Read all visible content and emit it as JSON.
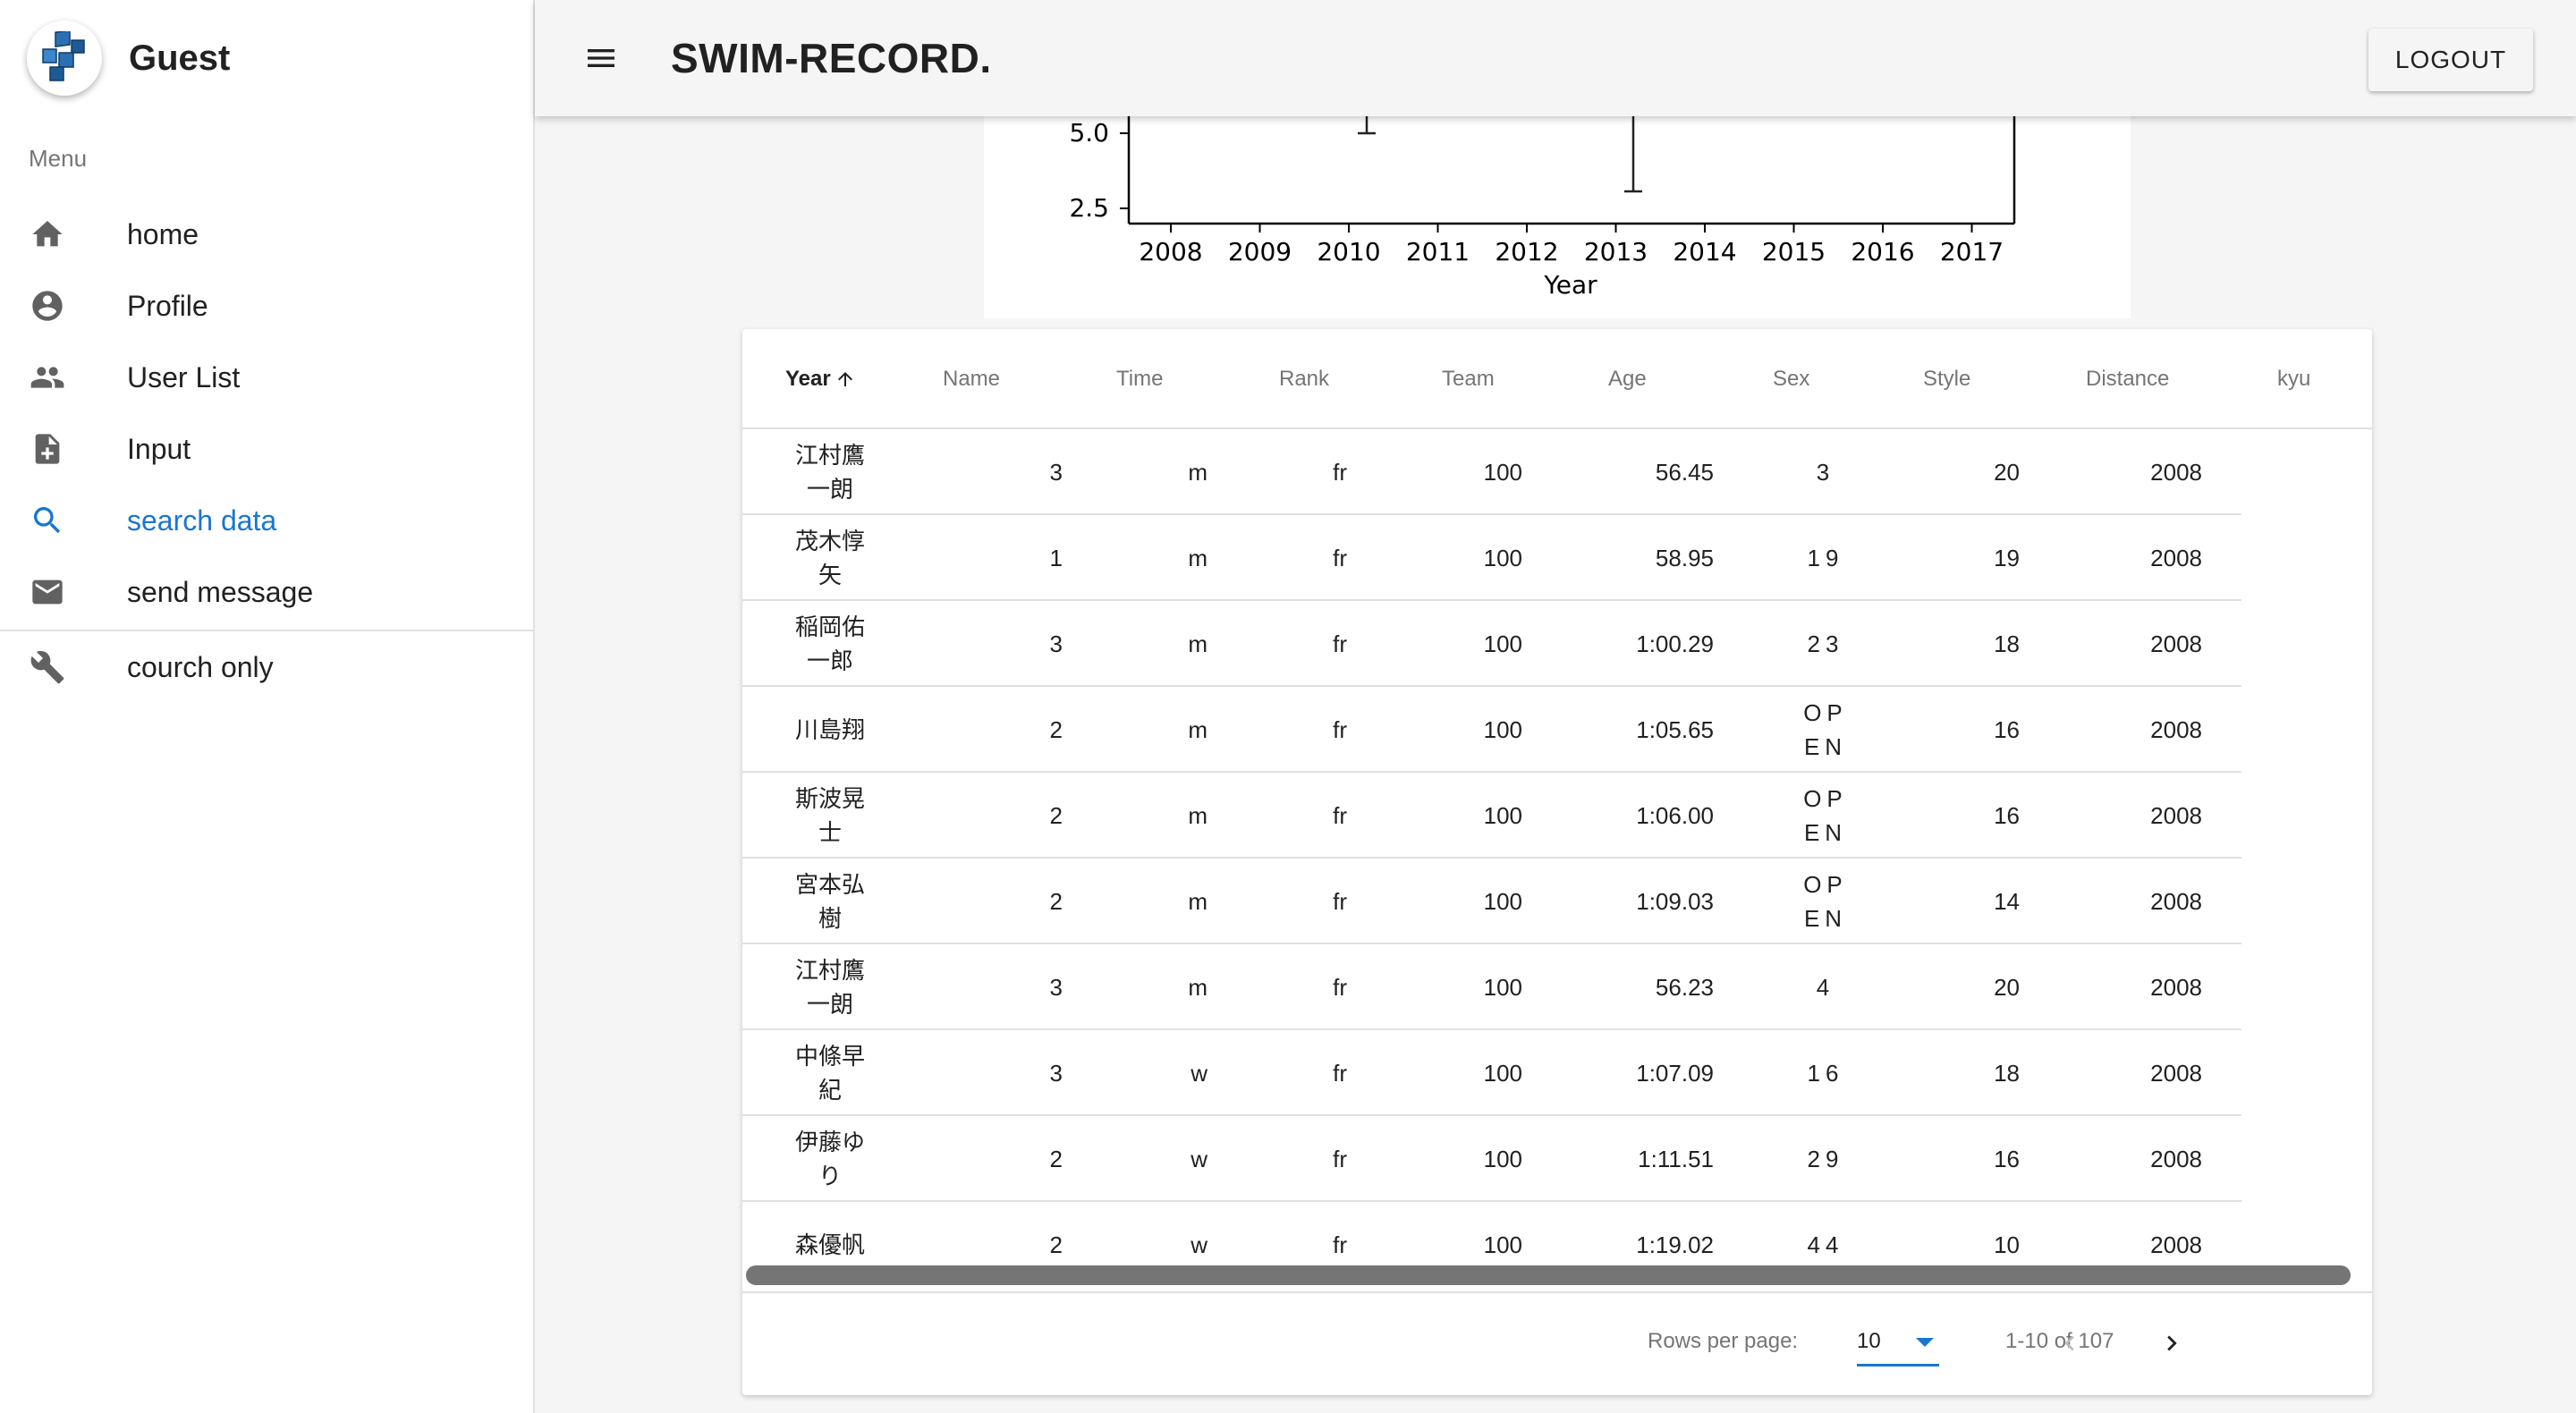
{
  "user": {
    "name": "Guest"
  },
  "sidebar": {
    "menu_label": "Menu",
    "items": [
      {
        "label": "home",
        "icon": "home-icon"
      },
      {
        "label": "Profile",
        "icon": "account-circle-icon"
      },
      {
        "label": "User List",
        "icon": "people-icon"
      },
      {
        "label": "Input",
        "icon": "note-add-icon"
      },
      {
        "label": "search data",
        "icon": "search-icon",
        "active": true
      },
      {
        "label": "send message",
        "icon": "mail-icon"
      },
      {
        "label": "courch only",
        "icon": "wrench-icon"
      }
    ]
  },
  "header": {
    "title": "SWIM-RECORD.",
    "logout_label": "LOGOUT"
  },
  "chart_data": {
    "type": "scatter",
    "xlabel": "Year",
    "x_ticks": [
      "2008",
      "2009",
      "2010",
      "2011",
      "2012",
      "2013",
      "2014",
      "2015",
      "2016",
      "2017"
    ],
    "y_ticks": [
      "5.0",
      "2.5"
    ],
    "visible_error_bars": [
      {
        "x": 2010,
        "y_low": 5.0
      },
      {
        "x": 2013,
        "y_low": 3.0
      }
    ]
  },
  "table": {
    "headers": [
      "Year",
      "Name",
      "Time",
      "Rank",
      "Team",
      "Age",
      "Sex",
      "Style",
      "Distance",
      "kyu"
    ],
    "sort_column": "Year",
    "rows": [
      {
        "name": "江村鷹一朗",
        "rank": "3",
        "sex": "m",
        "style": "fr",
        "distance": "100",
        "time": "56.45",
        "team": "3",
        "age": "20",
        "year": "2008"
      },
      {
        "name": "茂木惇矢",
        "rank": "1",
        "sex": "m",
        "style": "fr",
        "distance": "100",
        "time": "58.95",
        "team": "19",
        "age": "19",
        "year": "2008"
      },
      {
        "name": "稲岡佑一郎",
        "rank": "3",
        "sex": "m",
        "style": "fr",
        "distance": "100",
        "time": "1:00.29",
        "team": "23",
        "age": "18",
        "year": "2008"
      },
      {
        "name": "川島翔",
        "rank": "2",
        "sex": "m",
        "style": "fr",
        "distance": "100",
        "time": "1:05.65",
        "team": "OPEN",
        "age": "16",
        "year": "2008"
      },
      {
        "name": "斯波晃士",
        "rank": "2",
        "sex": "m",
        "style": "fr",
        "distance": "100",
        "time": "1:06.00",
        "team": "OPEN",
        "age": "16",
        "year": "2008"
      },
      {
        "name": "宮本弘樹",
        "rank": "2",
        "sex": "m",
        "style": "fr",
        "distance": "100",
        "time": "1:09.03",
        "team": "OPEN",
        "age": "14",
        "year": "2008"
      },
      {
        "name": "江村鷹一朗",
        "rank": "3",
        "sex": "m",
        "style": "fr",
        "distance": "100",
        "time": "56.23",
        "team": "4",
        "age": "20",
        "year": "2008"
      },
      {
        "name": "中條早紀",
        "rank": "3",
        "sex": "w",
        "style": "fr",
        "distance": "100",
        "time": "1:07.09",
        "team": "16",
        "age": "18",
        "year": "2008"
      },
      {
        "name": "伊藤ゆり",
        "rank": "2",
        "sex": "w",
        "style": "fr",
        "distance": "100",
        "time": "1:11.51",
        "team": "29",
        "age": "16",
        "year": "2008"
      },
      {
        "name": "森優帆",
        "rank": "2",
        "sex": "w",
        "style": "fr",
        "distance": "100",
        "time": "1:19.02",
        "team": "44",
        "age": "10",
        "year": "2008"
      }
    ]
  },
  "pagination": {
    "rows_per_page_label": "Rows per page:",
    "rows_per_page": "10",
    "range": "1-10 of 107"
  }
}
